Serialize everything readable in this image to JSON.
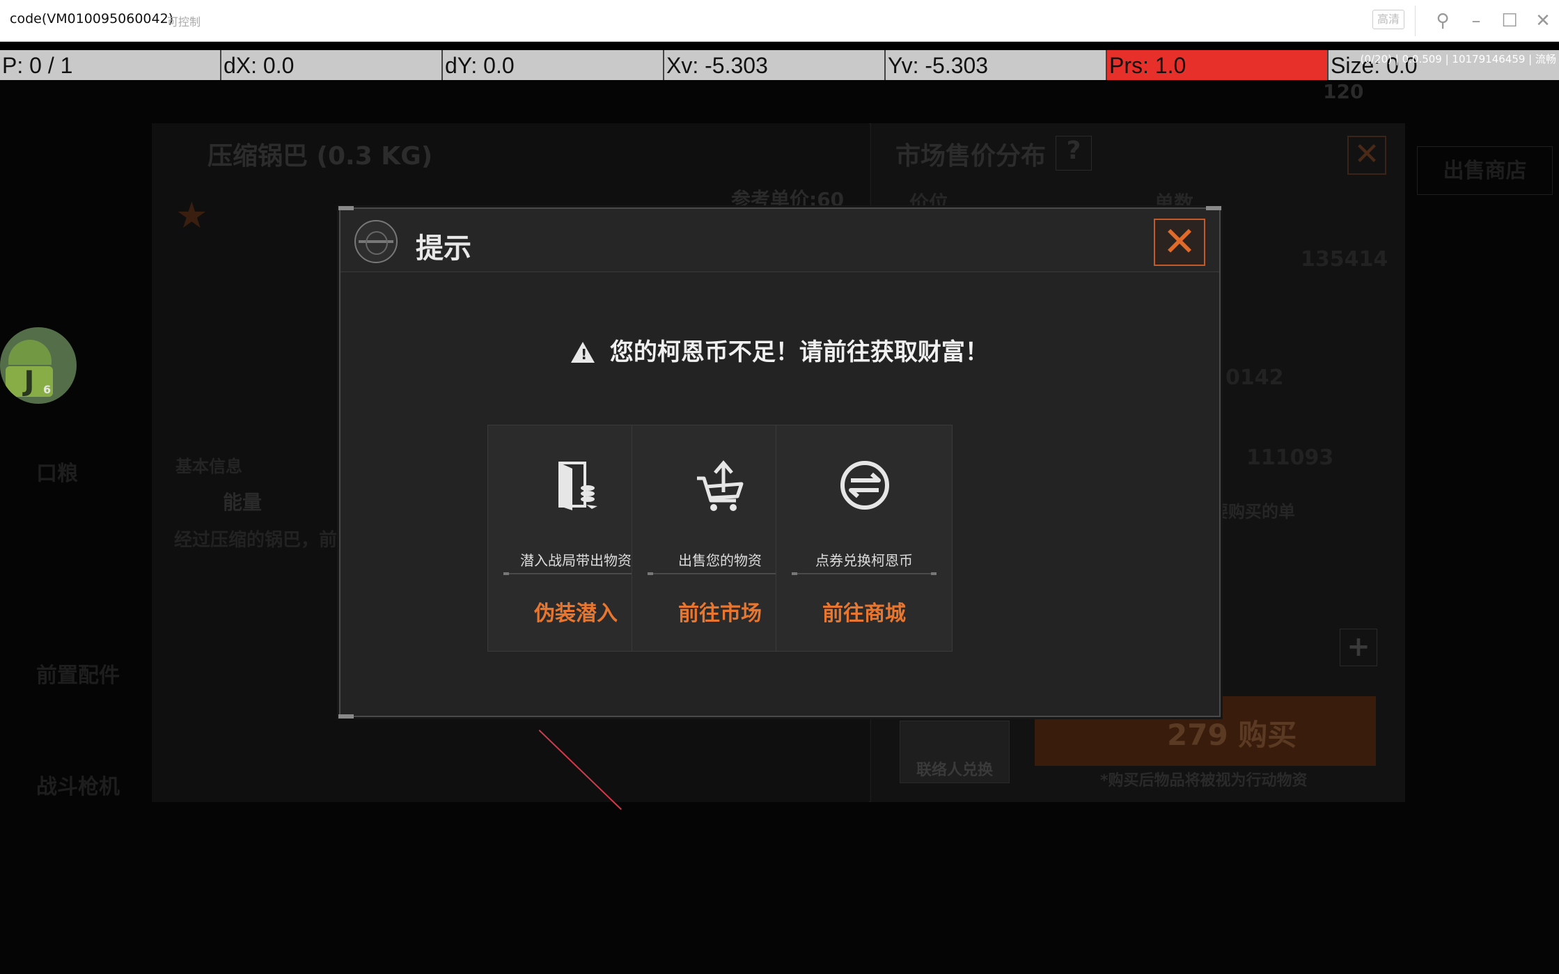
{
  "window": {
    "title": "code(VM010095060042)",
    "control_label": "可控制",
    "hd_label": "高清"
  },
  "debug": {
    "p": "P: 0 / 1",
    "dx": "dX: 0.0",
    "dy": "dY: 0.0",
    "xv": "Xv: -5.303",
    "yv": "Yv: -5.303",
    "prs": "Prs: 1.0",
    "size": "Size: 0.0",
    "info": "(0/20) | 0.0.509 | 10179146459 | 流畅"
  },
  "background": {
    "item_title": "压缩锅巴 (0.3 KG)",
    "ref_price": "参考单价:60",
    "market_title": "市场售价分布",
    "help": "?",
    "col_price": "价位",
    "col_count": "单数",
    "count1": "135414",
    "count2": "0142",
    "count3": "111093",
    "basic_info": "基本信息",
    "energy": "能量",
    "desc": "经过压缩的锅巴，前",
    "buy_wish": "要购买的单",
    "contact_exchange": "联络人兑换",
    "buy_label": "279 购买",
    "buy_note": "*购买后物品将被视为行动物资",
    "coins": "120",
    "side_1": "口粮",
    "side_2": "前置配件",
    "side_3": "战斗枪机",
    "top_tab": "出售商店"
  },
  "dialog": {
    "title": "提示",
    "close_icon": "close-icon",
    "warning": "您的柯恩币不足！请前往获取财富！",
    "options": [
      {
        "icon": "door-coins-icon",
        "desc": "潜入战局带出物资",
        "action": "伪装潜入"
      },
      {
        "icon": "cart-upload-icon",
        "desc": "出售您的物资",
        "action": "前往市场"
      },
      {
        "icon": "exchange-coin-icon",
        "desc": "点券兑换柯恩币",
        "action": "前往商城"
      }
    ]
  },
  "colors": {
    "accent": "#e8762e",
    "close_border": "#c45a2a",
    "prs_bg": "#e8302a"
  }
}
